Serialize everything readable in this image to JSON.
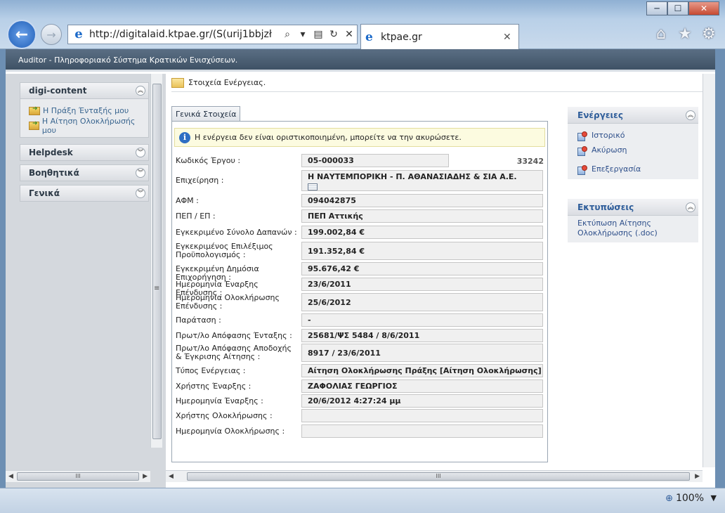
{
  "browser": {
    "url": "http://digitalaid.ktpae.gr/(S(urij1bbjzł",
    "tab_title": "ktpae.gr",
    "zoom": "100%"
  },
  "app": {
    "header_title": "Auditor - Πληροφοριακό Σύστημα Κρατικών Ενισχύσεων."
  },
  "sidebar": {
    "sections": [
      {
        "label": "digi-content",
        "items": [
          "Η Πράξη Ένταξής μου",
          "Η Αίτηση Ολοκλήρωσής μου"
        ]
      },
      {
        "label": "Helpdesk"
      },
      {
        "label": "Βοηθητικά"
      },
      {
        "label": "Γενικά"
      }
    ]
  },
  "breadcrumb": "Στοιχεία Ενέργειας.",
  "tab_general": "Γενικά Στοιχεία",
  "notice": "Η ενέργεια δεν είναι οριστικοποιημένη, μπορείτε να την ακυρώσετε.",
  "fields": [
    {
      "label": "Κωδικός Έργου :",
      "value": "05-000033",
      "extra": "33242"
    },
    {
      "label": "Επιχείρηση :",
      "value": "Η ΝΑΥΤΕΜΠΟΡΙΚΗ - Π. ΑΘΑΝΑΣΙΑΔΗΣ & ΣΙΑ Α.Ε."
    },
    {
      "label": "ΑΦΜ :",
      "value": "094042875"
    },
    {
      "label": "ΠΕΠ / ΕΠ :",
      "value": "ΠΕΠ Αττικής"
    },
    {
      "label": "Εγκεκριμένο Σύνολο Δαπανών :",
      "value": "199.002,84 €"
    },
    {
      "label": "Εγκεκριμένος Επιλέξιμος Προϋπολογισμός :",
      "value": "191.352,84 €"
    },
    {
      "label": "Εγκεκριμένη Δημόσια Επιχορήγηση :",
      "value": "95.676,42 €"
    },
    {
      "label": "Ημερομηνία Έναρξης Επένδυσης :",
      "value": "23/6/2011"
    },
    {
      "label": "Ημερομηνία Ολοκλήρωσης Επένδυσης :",
      "value": "25/6/2012"
    },
    {
      "label": "Παράταση :",
      "value": "-"
    },
    {
      "label": "Πρωτ/λο Απόφασης Ένταξης :",
      "value": "25681/ΨΣ 5484 / 8/6/2011"
    },
    {
      "label": "Πρωτ/λο Απόφασης Αποδοχής & Έγκρισης Αίτησης :",
      "value": "8917 / 23/6/2011"
    },
    {
      "label": "Τύπος Ενέργειας :",
      "value": "Αίτηση Ολοκλήρωσης Πράξης [Αίτηση Ολοκλήρωσης]"
    },
    {
      "label": "Χρήστης Έναρξης :",
      "value": "ΖΑΦΟΛΙΑΣ ΓΕΩΡΓΙΟΣ"
    },
    {
      "label": "Ημερομηνία Έναρξης :",
      "value": "20/6/2012 4:27:24 μμ"
    },
    {
      "label": "Χρήστης Ολοκλήρωσης :",
      "value": ""
    },
    {
      "label": "Ημερομηνία Ολοκλήρωσης :",
      "value": ""
    }
  ],
  "actions": {
    "title": "Ενέργειες",
    "items": [
      "Ιστορικό",
      "Ακύρωση",
      "Επεξεργασία"
    ]
  },
  "prints": {
    "title": "Εκτυπώσεις",
    "items": [
      "Εκτύπωση Αίτησης Ολοκλήρωσης (.doc)"
    ]
  }
}
